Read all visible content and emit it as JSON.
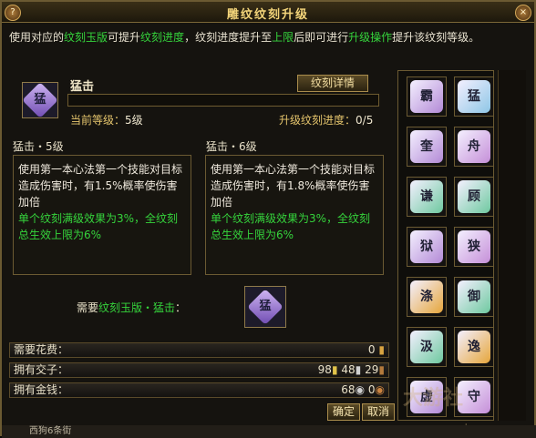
{
  "window": {
    "title": "雕纹纹刻升级",
    "help_glyph": "?",
    "close_glyph": "×"
  },
  "info": {
    "p1": "使用对应的",
    "g1": "纹刻玉版",
    "p2": "可提升",
    "g2": "纹刻进度",
    "p3": "，纹刻进度提升至",
    "g3": "上限",
    "p4": "后即可进行",
    "g4": "升级操作",
    "p5": "提升该纹刻等级。"
  },
  "skill": {
    "icon_char": "猛",
    "name": "猛击",
    "detail_button": "纹刻详情",
    "level_label": "当前等级：",
    "level_value": "5级",
    "progress_label": "升级纹刻进度：",
    "progress_value": "0/5",
    "progress_fraction": 0
  },
  "current": {
    "title": "猛击・5级",
    "desc": "使用第一本心法第一个技能对目标造成伤害时，有1.5%概率使伤害加倍",
    "note": "单个纹刻满级效果为3%，全纹刻总生效上限为6%"
  },
  "next": {
    "title": "猛击・6级",
    "desc": "使用第一本心法第一个技能对目标造成伤害时，有1.8%概率使伤害加倍",
    "note": "单个纹刻满级效果为3%，全纹刻总生效上限为6%"
  },
  "need": {
    "prefix": "需要",
    "item": "纹刻玉版・猛击",
    "suffix": "：",
    "icon_char": "猛"
  },
  "cost": {
    "label": "需要花费：",
    "value": "0"
  },
  "items": {
    "label": "拥有交子：",
    "a": "98",
    "b": "48",
    "c": "29"
  },
  "money": {
    "label": "拥有金钱：",
    "a": "68",
    "b": "0"
  },
  "buttons": {
    "confirm": "确定",
    "cancel": "取消"
  },
  "runes": [
    {
      "char": "霸",
      "color": "#b38ad6"
    },
    {
      "char": "猛",
      "color": "#8ec6e6"
    },
    {
      "char": "奎",
      "color": "#b38ad6"
    },
    {
      "char": "舟",
      "color": "#c58fd8"
    },
    {
      "char": "谦",
      "color": "#6fc9a0"
    },
    {
      "char": "顾",
      "color": "#6fc9a0"
    },
    {
      "char": "狱",
      "color": "#b38ad6"
    },
    {
      "char": "狭",
      "color": "#c58fd8"
    },
    {
      "char": "涤",
      "color": "#e6a63c"
    },
    {
      "char": "御",
      "color": "#6fc9a0"
    },
    {
      "char": "汲",
      "color": "#6fc9a0"
    },
    {
      "char": "逸",
      "color": "#e6a63c"
    },
    {
      "char": "虚",
      "color": "#b38ad6"
    },
    {
      "char": "守",
      "color": "#c58fd8"
    }
  ],
  "footer": "西狗6条街",
  "watermark": {
    "text": "大游社",
    "url": "www.sxbs.com"
  }
}
